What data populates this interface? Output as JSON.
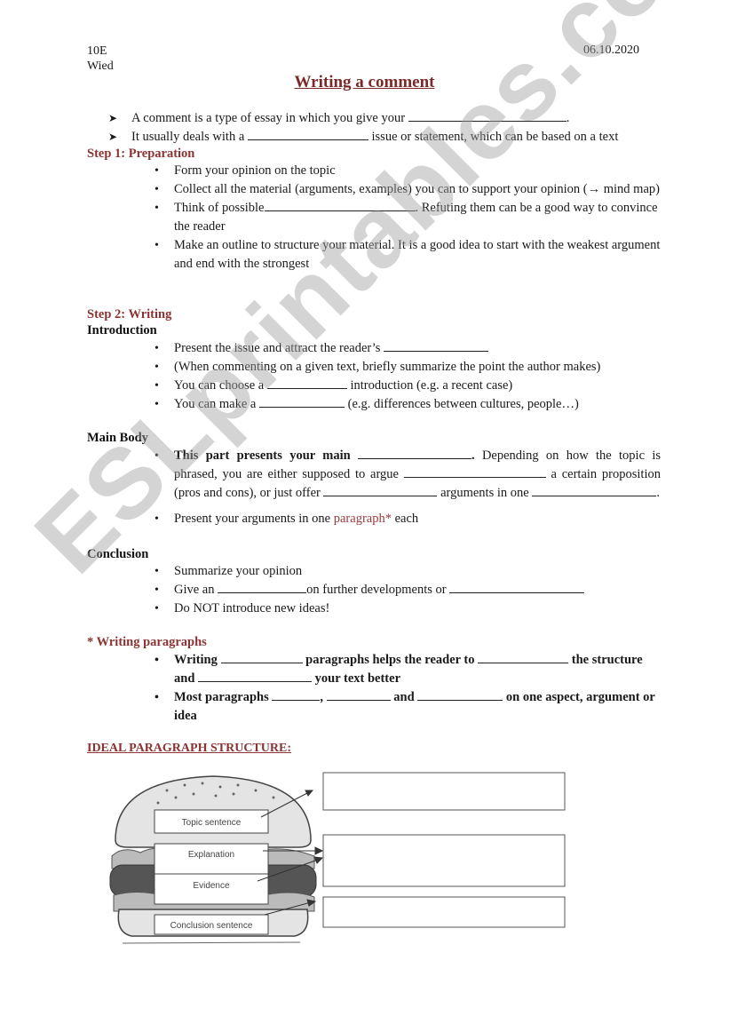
{
  "header": {
    "class": "10E",
    "author": "Wied",
    "date": "06.10.2020"
  },
  "title": "Writing a comment",
  "intro": [
    {
      "before": "A comment is a type of essay in which you give your ",
      "after": "."
    },
    {
      "before": "It usually deals with a ",
      "after": " issue or statement, which can be based on a text"
    }
  ],
  "step1": {
    "heading": "Step 1: Preparation",
    "items": [
      "Form your opinion on the topic",
      "Collect all the material (arguments, examples) you can to support your opinion (→ mind map)",
      {
        "before": "Think of possible",
        "after": ". Refuting them can be a good way to convince the reader"
      },
      "Make an outline to structure your material. It is a good idea to start with the weakest argument and end with the strongest"
    ]
  },
  "step2": {
    "heading": "Step 2: Writing",
    "introduction": {
      "heading": "Introduction",
      "items": [
        {
          "before": "Present the issue and attract the reader’s ",
          "after": ""
        },
        "(When commenting on a given text, briefly summarize the point the author makes)",
        {
          "before": "You can choose a ",
          "after": " introduction (e.g. a recent case)"
        },
        {
          "before": "You can make a ",
          "after": " (e.g. differences between cultures, people…)"
        }
      ]
    },
    "main_body": {
      "heading": "Main Body",
      "item1": {
        "bold_part": "This part presents your main ",
        "bold_end": ".",
        "p1": " Depending on how the topic is phrased, you are either supposed to argue ",
        "p2": " a certain proposition (pros and cons), or just offer ",
        "p3": " arguments in one ",
        "p4": "."
      },
      "item2": {
        "before": "Present your arguments in one ",
        "highlight": "paragraph*",
        "after": " each"
      }
    },
    "conclusion": {
      "heading": "Conclusion",
      "items": [
        "Summarize your opinion",
        {
          "before": "Give an ",
          "mid": "on further developments or ",
          "after": ""
        },
        "Do NOT introduce new ideas!"
      ]
    }
  },
  "paragraphs": {
    "heading": "* Writing paragraphs",
    "item1": {
      "a": "Writing ",
      "b": " paragraphs helps the reader to ",
      "c": " the structure and ",
      "d": " your text better"
    },
    "item2": {
      "a": "Most paragraphs ",
      "b": ", ",
      "c": " and ",
      "d": " on one aspect, argument or idea"
    }
  },
  "ideal_heading": "IDEAL PARAGRAPH STRUCTURE:",
  "burger": {
    "labels": [
      "Topic sentence",
      "Explanation",
      "Evidence",
      "Conclusion sentence"
    ],
    "answer_boxes": 3
  },
  "watermark": "ESLprintables.com",
  "colors": {
    "heading_red": "#8b3333",
    "title_red": "#7b2a2a"
  }
}
